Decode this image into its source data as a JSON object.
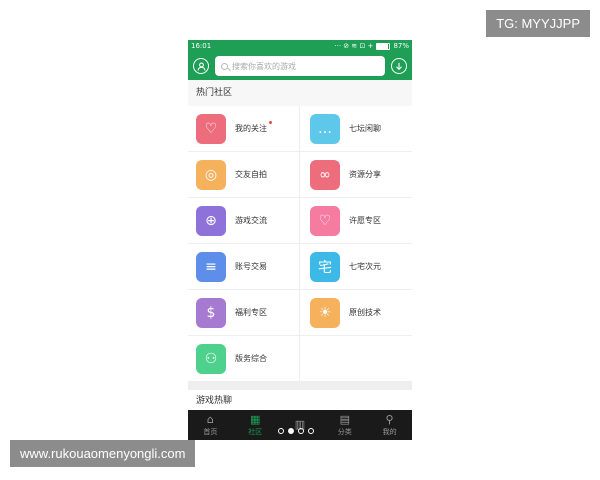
{
  "status_bar": {
    "time": "16:01",
    "icons": "··· ⊘ ≋ ⊡ +",
    "battery": "87%"
  },
  "header": {
    "search_placeholder": "搜索你喜欢的游戏",
    "user_icon": "user-icon",
    "download_icon": "download-icon"
  },
  "hot_section": {
    "title": "热门社区"
  },
  "items": [
    {
      "label": "我的关注",
      "color": "#ee6d7c",
      "icon": "heart-plus-icon",
      "glyph": "♡"
    },
    {
      "label": "七坛闲聊",
      "color": "#5ec8ea",
      "icon": "chat-bubble-icon",
      "glyph": "…"
    },
    {
      "label": "交友自拍",
      "color": "#f6b15d",
      "icon": "camera-icon",
      "glyph": "◎"
    },
    {
      "label": "资源分享",
      "color": "#ee6d7c",
      "icon": "link-icon",
      "glyph": "∞"
    },
    {
      "label": "游戏交流",
      "color": "#8f72d9",
      "icon": "gamepad-icon",
      "glyph": "⊕"
    },
    {
      "label": "许愿专区",
      "color": "#f57ba1",
      "icon": "heart-icon",
      "glyph": "♡"
    },
    {
      "label": "账号交易",
      "color": "#5d8ee9",
      "icon": "account-trade-icon",
      "glyph": "≡"
    },
    {
      "label": "七宅次元",
      "color": "#3cb9e6",
      "icon": "otaku-icon",
      "glyph": "宅"
    },
    {
      "label": "福利专区",
      "color": "#a57ad0",
      "icon": "piggy-bank-icon",
      "glyph": "$"
    },
    {
      "label": "原创技术",
      "color": "#f6b15d",
      "icon": "lightbulb-icon",
      "glyph": "☀"
    },
    {
      "label": "版务综合",
      "color": "#4fd18e",
      "icon": "group-icon",
      "glyph": "⚇"
    }
  ],
  "games_section": {
    "title": "游戏热聊"
  },
  "tabs": [
    {
      "label": "首页",
      "icon": "home-icon",
      "glyph": "⌂"
    },
    {
      "label": "社区",
      "icon": "community-grid-icon",
      "glyph": "▦"
    },
    {
      "label": "",
      "icon": "ranking-icon",
      "glyph": "▥"
    },
    {
      "label": "分类",
      "icon": "book-icon",
      "glyph": "▤"
    },
    {
      "label": "我的",
      "icon": "profile-icon",
      "glyph": "⚲"
    }
  ],
  "active_tab": 1,
  "pager_dots": 4,
  "active_dot": 1,
  "watermarks": {
    "top": "TG: MYYJJPP",
    "bottom": "www.rukouaomenyongli.com"
  }
}
